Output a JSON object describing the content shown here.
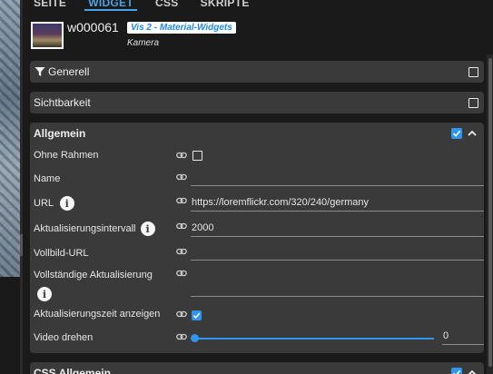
{
  "tabs": [
    {
      "label": "SEITE"
    },
    {
      "label": "WIDGET"
    },
    {
      "label": "CSS"
    },
    {
      "label": "SKRIPTE"
    }
  ],
  "widget": {
    "id": "w000061",
    "set": "Vis 2 - Material-Widgets",
    "type": "Kamera"
  },
  "groups": {
    "generell": {
      "title": "Generell",
      "checked": false
    },
    "sichtbarkeit": {
      "title": "Sichtbarkeit",
      "checked": false
    },
    "allgemein": {
      "title": "Allgemein",
      "checked": true,
      "expanded": true
    },
    "css_allgemein": {
      "title": "CSS Allgemein",
      "checked": true
    }
  },
  "fields": {
    "ohne_rahmen": {
      "label": "Ohne Rahmen",
      "checked": false
    },
    "name": {
      "label": "Name",
      "value": ""
    },
    "url": {
      "label": "URL",
      "value": "https://loremflickr.com/320/240/germany"
    },
    "interval": {
      "label": "Aktualisierungsintervall",
      "value": "2000"
    },
    "vollbild_url": {
      "label": "Vollbild-URL",
      "value": ""
    },
    "full_refresh": {
      "label": "Vollständige Aktualisierung",
      "value": ""
    },
    "show_time": {
      "label": "Aktualisierungszeit anzeigen",
      "checked": true
    },
    "rotate": {
      "label": "Video drehen",
      "value": "0",
      "slider_fraction": 0
    }
  },
  "icons": {
    "filter": "filter-icon",
    "link": "link-icon",
    "info": "info-icon",
    "chevron": "chevron-up-icon"
  },
  "colors": {
    "accent": "#2f96f0",
    "tab_active": "#4aa3e8",
    "panel": "#3a3a3a",
    "background": "#1a1a1a"
  }
}
